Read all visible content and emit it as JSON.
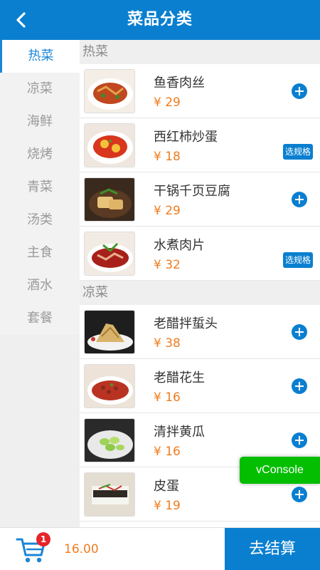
{
  "header": {
    "title": "菜品分类"
  },
  "sidebar": {
    "categories": [
      {
        "label": "热菜"
      },
      {
        "label": "凉菜"
      },
      {
        "label": "海鲜"
      },
      {
        "label": "烧烤"
      },
      {
        "label": "青菜"
      },
      {
        "label": "汤类"
      },
      {
        "label": "主食"
      },
      {
        "label": "酒水"
      },
      {
        "label": "套餐"
      }
    ]
  },
  "sections": [
    {
      "title": "热菜",
      "dishes": [
        {
          "name": "鱼香肉丝",
          "price": "¥ 29",
          "action": "add"
        },
        {
          "name": "西红柿炒蛋",
          "price": "¥ 18",
          "action": "spec",
          "spec_label": "选规格"
        },
        {
          "name": "干锅千页豆腐",
          "price": "¥ 29",
          "action": "add"
        },
        {
          "name": "水煮肉片",
          "price": "¥ 32",
          "action": "spec",
          "spec_label": "选规格"
        }
      ]
    },
    {
      "title": "凉菜",
      "dishes": [
        {
          "name": "老醋拌蜇头",
          "price": "¥ 38",
          "action": "add"
        },
        {
          "name": "老醋花生",
          "price": "¥ 16",
          "action": "add"
        },
        {
          "name": "清拌黄瓜",
          "price": "¥ 16",
          "action": "add"
        },
        {
          "name": "皮蛋",
          "price": "¥ 19",
          "action": "add"
        }
      ]
    }
  ],
  "vconsole": {
    "label": "vConsole"
  },
  "footer": {
    "cart_count": "1",
    "total": "16.00",
    "checkout_label": "去结算"
  },
  "colors": {
    "primary": "#0a7fd0",
    "price": "#f07c1e",
    "badge": "#e5242b",
    "vconsole": "#04be02"
  },
  "icons": {
    "back": "chevron-left-icon",
    "cart": "cart-icon",
    "add": "plus-circle-icon"
  }
}
